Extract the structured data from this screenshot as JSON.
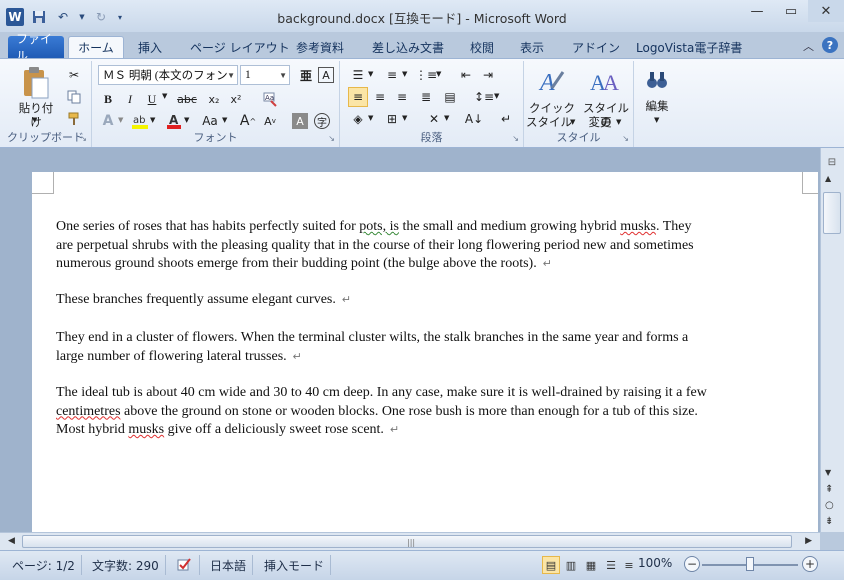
{
  "window": {
    "title": "background.docx [互換モード] - Microsoft Word"
  },
  "tabs": [
    {
      "label": "ファイル"
    },
    {
      "label": "ホーム"
    },
    {
      "label": "挿入"
    },
    {
      "label": "ページ レイアウト"
    },
    {
      "label": "参考資料"
    },
    {
      "label": "差し込み文書"
    },
    {
      "label": "校閲"
    },
    {
      "label": "表示"
    },
    {
      "label": "アドイン"
    },
    {
      "label": "LogoVista電子辞書"
    }
  ],
  "ribbon": {
    "clipboard": {
      "paste_label": "貼り付け",
      "group_label": "クリップボード"
    },
    "font": {
      "font_name": "ＭＳ 明朝 (本文のフォン",
      "font_size": "1",
      "group_label": "フォント"
    },
    "paragraph": {
      "group_label": "段落"
    },
    "styles": {
      "quick_label1": "クイック",
      "quick_label2": "スタイル",
      "change_label1": "スタイルの",
      "change_label2": "変更",
      "group_label": "スタイル"
    },
    "editing": {
      "label": "編集"
    }
  },
  "document": {
    "paragraphs": [
      {
        "lines": [
          "One series of roses that has habits perfectly suited for pots, is the small and medium growing hybrid musks. They",
          "are perpetual shrubs with the pleasing quality that in the course of their long flowering period new and sometimes",
          "numerous ground shoots emerge from their budding point (the bulge above the roots)."
        ]
      },
      {
        "lines": [
          "These branches frequently assume elegant curves."
        ]
      },
      {
        "lines": [
          "They end in a cluster of flowers. When the terminal cluster wilts, the stalk branches in the same year and forms a",
          "large number of flowering lateral trusses."
        ]
      },
      {
        "lines": [
          "The ideal tub is about 40 cm wide and 30 to 40 cm deep. In any case, make sure it is well-drained by raising it a few",
          "centimetres above the ground on stone or wooden blocks. One rose bush is more than enough for a tub of this size.",
          "Most hybrid musks give off a deliciously sweet rose scent."
        ]
      }
    ],
    "paragraph_mark": "↵"
  },
  "status": {
    "page": "ページ: 1/2",
    "words": "文字数: 290",
    "language": "日本語",
    "mode": "挿入モード",
    "zoom": "100%",
    "zoom_level": 1.0
  }
}
